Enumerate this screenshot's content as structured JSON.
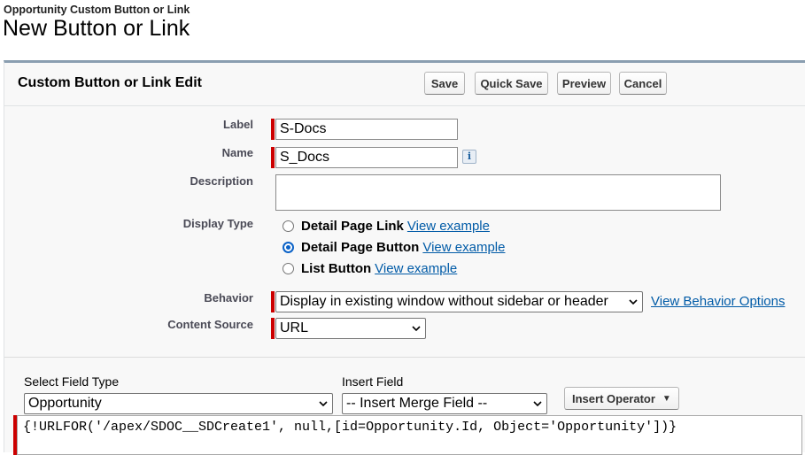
{
  "header": {
    "breadcrumb": "Opportunity Custom Button or Link",
    "title": "New Button or Link"
  },
  "panel": {
    "title": "Custom Button or Link Edit",
    "buttons": {
      "save": "Save",
      "quick_save": "Quick Save",
      "preview": "Preview",
      "cancel": "Cancel"
    }
  },
  "form": {
    "label": {
      "caption": "Label",
      "value": "S-Docs"
    },
    "name": {
      "caption": "Name",
      "value": "S_Docs",
      "info_icon": "info-icon"
    },
    "description": {
      "caption": "Description",
      "value": ""
    },
    "display_type": {
      "caption": "Display Type",
      "options": [
        {
          "label": "Detail Page Link",
          "link": "View example",
          "checked": false
        },
        {
          "label": "Detail Page Button",
          "link": "View example",
          "checked": true
        },
        {
          "label": "List Button",
          "link": "View example",
          "checked": false
        }
      ]
    },
    "behavior": {
      "caption": "Behavior",
      "selected": "Display in existing window without sidebar or header",
      "options_link": "View Behavior Options"
    },
    "content_source": {
      "caption": "Content Source",
      "selected": "URL"
    }
  },
  "formula_editor": {
    "field_type": {
      "caption": "Select Field Type",
      "selected": "Opportunity"
    },
    "insert_field": {
      "caption": "Insert Field",
      "selected": "-- Insert Merge Field --"
    },
    "insert_operator": "Insert Operator",
    "formula": "{!URLFOR('/apex/SDOC__SDCreate1', null,[id=Opportunity.Id, Object='Opportunity'])}"
  },
  "colors": {
    "required": "#cc0000",
    "link": "#015ba7",
    "radio_accent": "#0b62c7",
    "panel_border": "#8a9eb0"
  }
}
